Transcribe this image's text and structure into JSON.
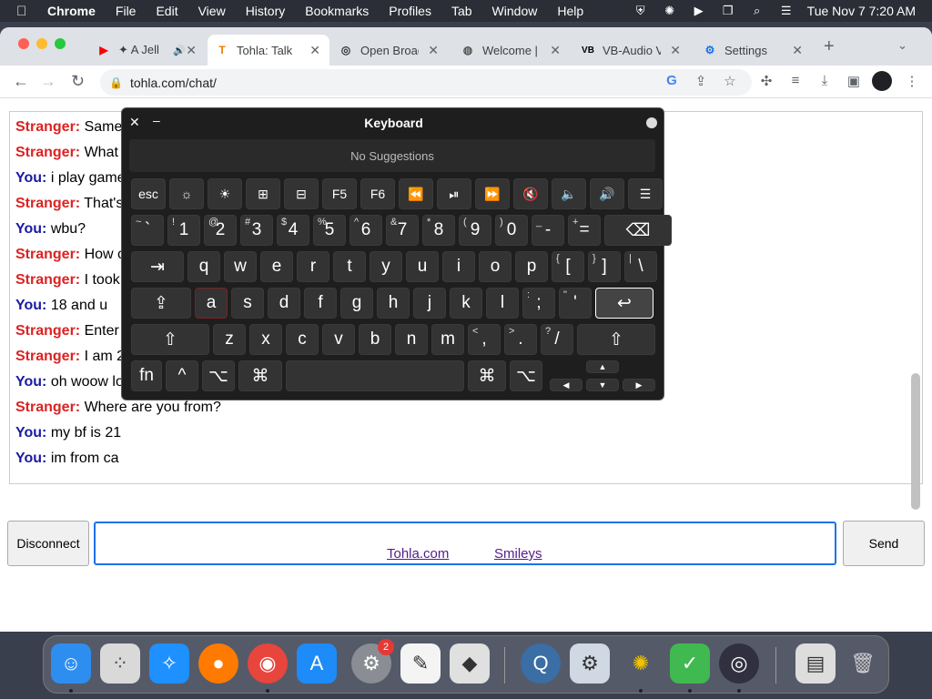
{
  "menubar": {
    "app": "Chrome",
    "items": [
      "File",
      "Edit",
      "View",
      "History",
      "Bookmarks",
      "Profiles",
      "Tab",
      "Window",
      "Help"
    ],
    "clock": "Tue Nov 7  7:20 AM"
  },
  "tabs": [
    {
      "title": "✦ A Jell",
      "icon": "youtube-icon",
      "color": "#ff0000"
    },
    {
      "title": "Tohla: Talk",
      "icon": "tohla-icon",
      "color": "#f57c00"
    },
    {
      "title": "Open Broad",
      "icon": "obs-icon",
      "color": "#333333"
    },
    {
      "title": "Welcome |",
      "icon": "globe-icon",
      "color": "#555555"
    },
    {
      "title": "VB-Audio V",
      "icon": "vb-icon",
      "color": "#000000"
    },
    {
      "title": "Settings",
      "icon": "gear-icon",
      "color": "#1a73e8"
    }
  ],
  "address": "tohla.com/chat/",
  "chat": [
    {
      "who": "Stranger:",
      "role": "stranger",
      "text": "Same"
    },
    {
      "who": "Stranger:",
      "role": "stranger",
      "text": "What"
    },
    {
      "who": "You:",
      "role": "you",
      "text": "i play game"
    },
    {
      "who": "Stranger:",
      "role": "stranger",
      "text": "That's"
    },
    {
      "who": "You:",
      "role": "you",
      "text": "wbu?"
    },
    {
      "who": "Stranger:",
      "role": "stranger",
      "text": "How c"
    },
    {
      "who": "Stranger:",
      "role": "stranger",
      "text": "I took"
    },
    {
      "who": "You:",
      "role": "you",
      "text": "18 and u"
    },
    {
      "who": "Stranger:",
      "role": "stranger",
      "text": "Enter"
    },
    {
      "who": "Stranger:",
      "role": "stranger",
      "text": "I am 2"
    },
    {
      "who": "You:",
      "role": "you",
      "text": "oh woow lo"
    },
    {
      "who": "Stranger:",
      "role": "stranger",
      "text": "Where are you from?"
    },
    {
      "who": "You:",
      "role": "you",
      "text": "my bf  is 21"
    },
    {
      "who": "You:",
      "role": "you",
      "text": "im from ca"
    }
  ],
  "controls": {
    "disconnect": "Disconnect",
    "send": "Send",
    "input_value": ""
  },
  "footer": {
    "link1": "Tohla.com",
    "link2": "Smileys"
  },
  "keyboard": {
    "title": "Keyboard",
    "suggestions": "No Suggestions",
    "rows": [
      [
        {
          "l": "esc"
        },
        {
          "l": "☼"
        },
        {
          "l": "☀"
        },
        {
          "l": "⊞"
        },
        {
          "l": "⊟"
        },
        {
          "l": "F5"
        },
        {
          "l": "F6"
        },
        {
          "l": "⏪"
        },
        {
          "l": "⏯"
        },
        {
          "l": "⏩"
        },
        {
          "l": "🔇"
        },
        {
          "l": "🔈"
        },
        {
          "l": "🔊"
        },
        {
          "l": "☰"
        }
      ],
      [
        {
          "s": "~",
          "l": "`"
        },
        {
          "s": "!",
          "l": "1"
        },
        {
          "s": "@",
          "l": "2"
        },
        {
          "s": "#",
          "l": "3"
        },
        {
          "s": "$",
          "l": "4"
        },
        {
          "s": "%",
          "l": "5"
        },
        {
          "s": "^",
          "l": "6"
        },
        {
          "s": "&",
          "l": "7"
        },
        {
          "s": "*",
          "l": "8"
        },
        {
          "s": "(",
          "l": "9"
        },
        {
          "s": ")",
          "l": "0"
        },
        {
          "s": "_",
          "l": "-"
        },
        {
          "s": "+",
          "l": "="
        },
        {
          "l": "⌫"
        }
      ],
      [
        {
          "l": "⇥"
        },
        {
          "l": "q"
        },
        {
          "l": "w"
        },
        {
          "l": "e"
        },
        {
          "l": "r"
        },
        {
          "l": "t"
        },
        {
          "l": "y"
        },
        {
          "l": "u"
        },
        {
          "l": "i"
        },
        {
          "l": "o"
        },
        {
          "l": "p"
        },
        {
          "s": "{",
          "l": "["
        },
        {
          "s": "}",
          "l": "]"
        },
        {
          "s": "|",
          "l": "\\"
        }
      ],
      [
        {
          "l": "⇪"
        },
        {
          "l": "a"
        },
        {
          "l": "s"
        },
        {
          "l": "d"
        },
        {
          "l": "f"
        },
        {
          "l": "g"
        },
        {
          "l": "h"
        },
        {
          "l": "j"
        },
        {
          "l": "k"
        },
        {
          "l": "l"
        },
        {
          "s": ":",
          "l": ";"
        },
        {
          "s": "\"",
          "l": "'"
        },
        {
          "l": "↩"
        }
      ],
      [
        {
          "l": "⇧"
        },
        {
          "l": "z"
        },
        {
          "l": "x"
        },
        {
          "l": "c"
        },
        {
          "l": "v"
        },
        {
          "l": "b"
        },
        {
          "l": "n"
        },
        {
          "l": "m"
        },
        {
          "s": "<",
          "l": ","
        },
        {
          "s": ">",
          "l": "."
        },
        {
          "s": "?",
          "l": "/"
        },
        {
          "l": "⇧"
        }
      ],
      [
        {
          "l": "fn"
        },
        {
          "l": "^"
        },
        {
          "l": "⌥"
        },
        {
          "l": "⌘"
        },
        {
          "l": ""
        },
        {
          "l": "⌘"
        },
        {
          "l": "⌥"
        },
        {
          "l": "◀"
        },
        {
          "l": "▲"
        },
        {
          "l": "▼"
        },
        {
          "l": "▶"
        }
      ]
    ]
  },
  "dock": {
    "apps": [
      "finder",
      "launchpad",
      "safari",
      "firefox",
      "chrome",
      "app-store",
      "system-settings",
      "textedit",
      "roblox",
      "quicktime",
      "settings-gear",
      "bee",
      "adguard",
      "obs",
      "documents",
      "trash"
    ],
    "badge": "2"
  }
}
